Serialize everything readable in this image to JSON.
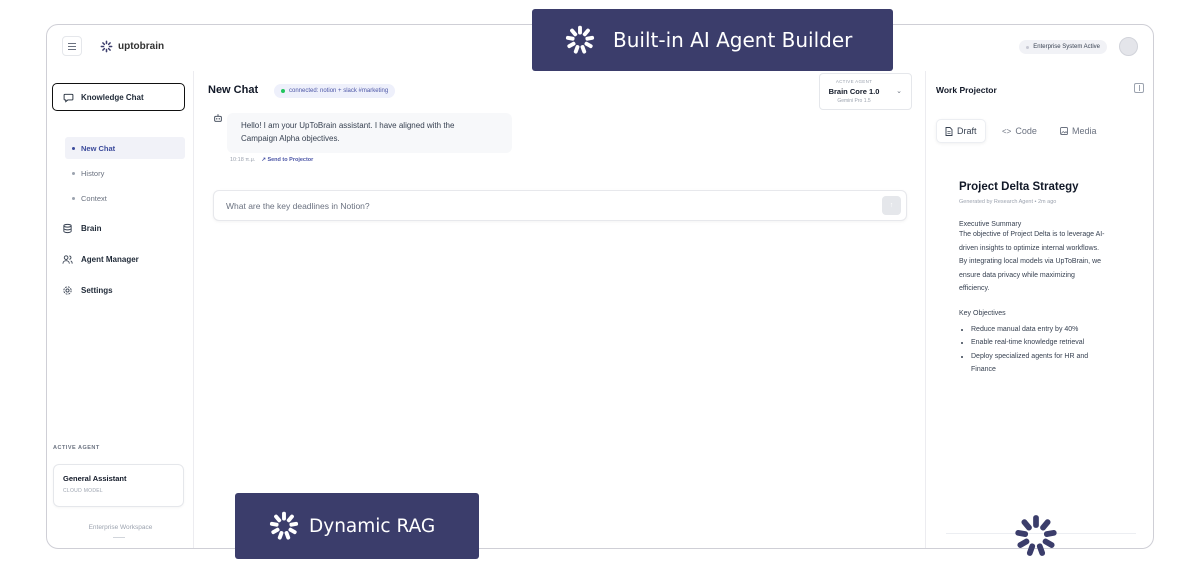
{
  "app": {
    "logo_text": "uptobrain",
    "enterprise_status": "Enterprise System Active"
  },
  "sidebar": {
    "active_nav": "Knowledge Chat",
    "sub_items": [
      {
        "label": "New Chat",
        "selected": true
      },
      {
        "label": "History",
        "selected": false
      },
      {
        "label": "Context",
        "selected": false
      }
    ],
    "nav_items": [
      {
        "label": "Brain",
        "icon": "database-icon"
      },
      {
        "label": "Agent Manager",
        "icon": "users-icon"
      },
      {
        "label": "Settings",
        "icon": "gear-icon"
      }
    ],
    "active_agent_title": "ACTIVE AGENT",
    "active_agent_name": "General Assistant",
    "active_agent_type": "CLOUD MODEL",
    "workspace": "Enterprise Workspace"
  },
  "chat": {
    "title": "New Chat",
    "connection": "connected: notion + slack #marketing",
    "agent_select": {
      "label": "ACTIVE AGENT",
      "value": "Brain Core 1.0",
      "sub": "Gemini Pro 1.5"
    },
    "messages": [
      {
        "line1": "Hello! I am your UpToBrain assistant. I have aligned with the",
        "line2": "Campaign Alpha objectives.",
        "time": "10:18 π.μ.",
        "action": "Send to Projector"
      }
    ],
    "input_value": "What are the key deadlines in Notion?"
  },
  "projector": {
    "title": "Work Projector",
    "tabs": [
      {
        "label": "Draft",
        "icon": "document-icon",
        "selected": true
      },
      {
        "label": "Code",
        "icon": "code-icon",
        "selected": false
      },
      {
        "label": "Media",
        "icon": "image-icon",
        "selected": false
      }
    ],
    "doc": {
      "title": "Project Delta Strategy",
      "meta": "Generated by Research Agent • 2m ago",
      "summary_heading": "Executive Summary",
      "summary": [
        "The objective of Project Delta is to leverage AI-",
        "driven insights to optimize internal workflows.",
        "By integrating local models via UpToBrain, we",
        "ensure data privacy while maximizing",
        "efficiency."
      ],
      "objectives_heading": "Key Objectives",
      "objectives": [
        "Reduce manual data entry by 40%",
        "Enable real-time knowledge retrieval",
        "Deploy specialized agents for HR and",
        "Finance"
      ]
    }
  },
  "banners": {
    "top": "Built-in AI Agent Builder",
    "bottom": "Dynamic RAG"
  },
  "colors": {
    "banner_bg": "#3b3d6b",
    "accent": "#4b55a6",
    "connected_dot": "#22c55e",
    "logo_mark": "#3b3d6b"
  }
}
